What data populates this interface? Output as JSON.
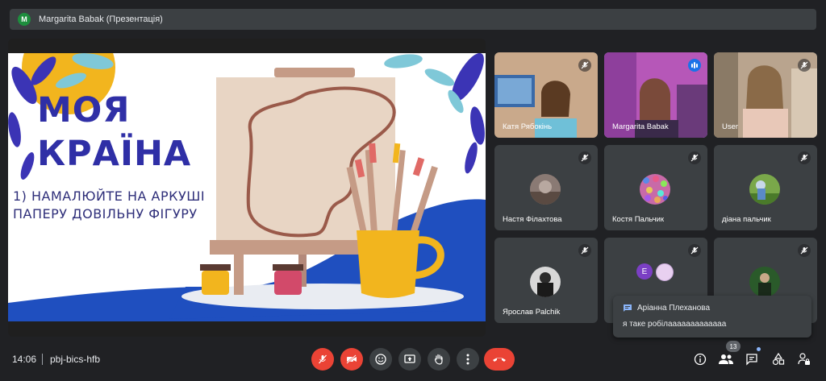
{
  "presenter_bar": {
    "avatar_letter": "M",
    "title": "Margarita Babak (Презентація)"
  },
  "slide": {
    "title_line1": "МОЯ",
    "title_line2": "КРАЇНА",
    "subtitle_line1": "1) НАМАЛЮЙТЕ НА АРКУШІ",
    "subtitle_line2": "ПАПЕРУ ДОВІЛЬНУ ФІГУРУ",
    "colors": {
      "title": "#2f2fa6",
      "blue": "#1f4fbf",
      "yellow": "#f2b51e",
      "canvas": "#e8d5c4"
    }
  },
  "participants": [
    {
      "name": "Катя Рябокінь",
      "muted": true,
      "video": true
    },
    {
      "name": "Margarita Babak",
      "muted": false,
      "speaking": true,
      "video": true
    },
    {
      "name": "User",
      "muted": true,
      "video": true
    },
    {
      "name": "Настя Філахтова",
      "muted": true,
      "video": false
    },
    {
      "name": "Костя Пальчик",
      "muted": true,
      "video": false
    },
    {
      "name": "діана пальчик",
      "muted": true,
      "video": false
    },
    {
      "name": "Ярослав Palchik",
      "muted": true,
      "video": false
    },
    {
      "name": "",
      "muted": true,
      "video": false,
      "avatar_letter": "E"
    },
    {
      "name": "",
      "muted": true,
      "video": false
    }
  ],
  "chat_toast": {
    "sender": "Аріанна Плеханова",
    "message": "я таке робілааааааааааааа"
  },
  "bottom_bar": {
    "time": "14:06",
    "meeting_code": "pbj-bics-hfb",
    "participants_count": "13"
  }
}
